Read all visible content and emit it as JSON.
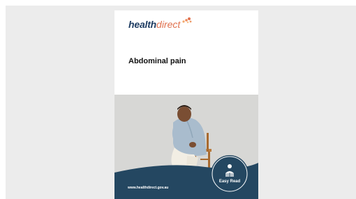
{
  "document": {
    "logo": {
      "health": "health",
      "direct": "direct"
    },
    "title": "Abdominal pain",
    "url": "www.healthdirect.gov.au",
    "badge": {
      "label": "Easy Read",
      "icon": "reading-person-icon"
    }
  },
  "colors": {
    "background": "#ececec",
    "navy": "#1f3d63",
    "orange": "#e0714f",
    "wave": "#244761"
  }
}
